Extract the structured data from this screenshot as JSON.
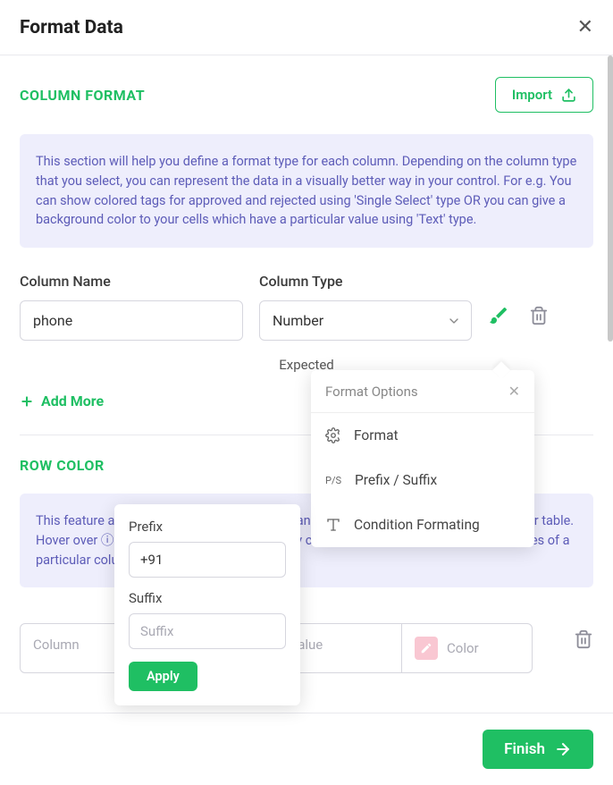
{
  "header": {
    "title": "Format Data"
  },
  "column_format": {
    "title": "COLUMN FORMAT",
    "import_label": "Import",
    "info": "This section will help you define a format type for each column. Depending on the column type that you select, you can represent the data in a visually better way in your control. For e.g. You can show colored tags for approved and rejected using 'Single Select' type OR you can give a background color to your cells which have a particular value using 'Text' type.",
    "column_name_label": "Column Name",
    "column_type_label": "Column Type",
    "column_name_value": "phone",
    "column_type_value": "Number",
    "expected_label": "Expected",
    "add_more_label": "Add More"
  },
  "format_options": {
    "title": "Format Options",
    "items": [
      {
        "label": "Format"
      },
      {
        "label": "Prefix / Suffix"
      },
      {
        "label": "Condition Formating"
      }
    ]
  },
  "prefix_suffix": {
    "prefix_label": "Prefix",
    "prefix_value": "+91",
    "suffix_label": "Suffix",
    "suffix_placeholder": "Suffix",
    "apply_label": "Apply"
  },
  "row_color": {
    "title": "ROW COLOR",
    "info": "This feature allows you to visually identify meaningful distinctions between rows in your table. Hover over ⓘ to see the details. You can apply colors using different operators on values of a particular column.",
    "column_placeholder": "Column",
    "value_placeholder": "Value",
    "color_placeholder": "Color"
  },
  "footer": {
    "finish_label": "Finish"
  }
}
